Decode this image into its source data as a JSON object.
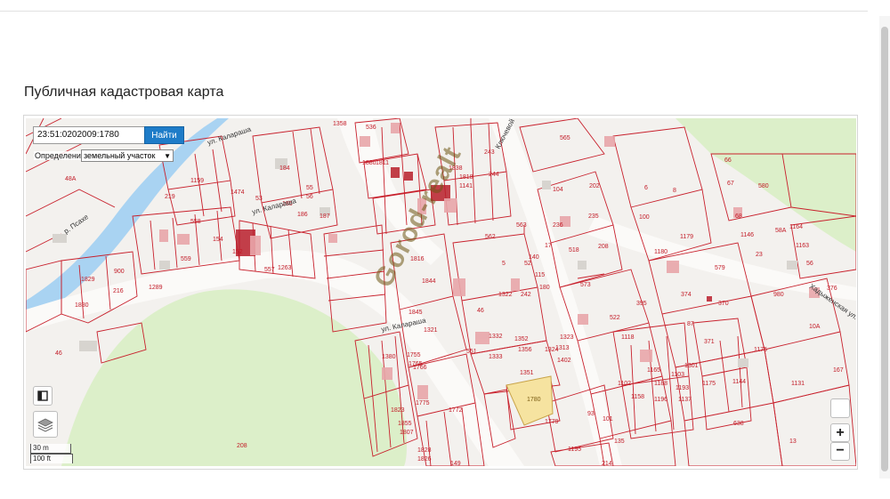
{
  "page": {
    "title": "Публичная кадастровая карта"
  },
  "search": {
    "value": "23:51:0202009:1780",
    "button_label": "Найти"
  },
  "definition": {
    "label": "Определение:",
    "selected": "земельный участок"
  },
  "map": {
    "watermark": "Gorod-realt",
    "selected_parcel": "1780",
    "streets": [
      "ул. Калараша",
      "ул. Калараша",
      "ул. Калараша",
      "р. Псахе",
      "Ключевой пер.",
      "Хадыженская ул."
    ],
    "parcel_labels": [
      "1358",
      "536",
      "565",
      "1880",
      "1811",
      "1838",
      "1818",
      "1141",
      "243",
      "244",
      "104",
      "202",
      "236",
      "235",
      "184",
      "55",
      "56",
      "219",
      "1159",
      "1474",
      "53",
      "185",
      "186",
      "187",
      "188",
      "48А",
      "558",
      "559",
      "154",
      "1267",
      "1216",
      "1263",
      "557",
      "1816",
      "1844",
      "1845",
      "562",
      "563",
      "518",
      "208",
      "1180",
      "579",
      "374",
      "370",
      "395",
      "1289",
      "900",
      "216",
      "1829",
      "1830",
      "46",
      "1351",
      "1402",
      "1779",
      "1195",
      "214",
      "93",
      "101",
      "135",
      "149",
      "208",
      "638",
      "1176",
      "1131",
      "167",
      "13",
      "1164",
      "1163",
      "56",
      "980",
      "376",
      "1144",
      "1137",
      "573",
      "522",
      "1118",
      "100",
      "1179",
      "67",
      "580",
      "66",
      "68",
      "1146",
      "23",
      "1149",
      "58А",
      "1352",
      "242",
      "1322",
      "46",
      "551",
      "1333",
      "1356",
      "1380",
      "1823",
      "1855",
      "1807",
      "1755",
      "1765",
      "1766",
      "1775",
      "1772",
      "1828",
      "1826",
      "6",
      "8",
      "371",
      "10А",
      "87",
      "1102",
      "1158",
      "1188",
      "1193",
      "1196",
      "1103",
      "1175",
      "1301",
      "1165",
      "1323",
      "1313",
      "1324",
      "5",
      "115",
      "180",
      "17",
      "140",
      "52",
      "1321",
      "1332"
    ],
    "attribution": "208"
  },
  "scale": {
    "metric": "30 m",
    "imperial": "100 ft"
  },
  "controls": {
    "zoom_in": "+",
    "zoom_out": "−"
  },
  "colors": {
    "parcel_stroke": "#c8202c",
    "parcel_fill_dark": "#b91f2b",
    "selected_fill": "#f6e3a0",
    "park": "#dcefc9",
    "river": "#a9d3f2",
    "button": "#1e7cc8"
  }
}
